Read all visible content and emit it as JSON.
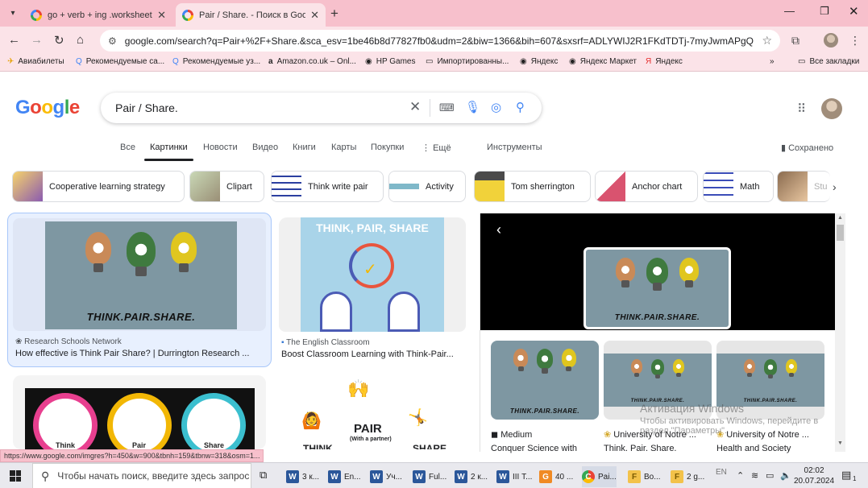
{
  "browser": {
    "tabs": [
      {
        "title": "go + verb + ing .worksheets pr"
      },
      {
        "title": "Pair / Share. - Поиск в Google"
      }
    ],
    "url": "google.com/search?q=Pair+%2F+Share.&sca_esv=1be46b8d77827fb0&udm=2&biw=1366&bih=607&sxsrf=ADLYWIJ2R1FKdTDTj-7myJwmAPgQkowRtg%3A1...",
    "bookmarks": [
      "Авиабилеты",
      "Рекомендуемые са...",
      "Рекомендуемые уз...",
      "Amazon.co.uk – Onl...",
      "HP Games",
      "Импортированны...",
      "Яндекс",
      "Яндекс Маркет",
      "Яндекс"
    ],
    "all_bookmarks": "Все закладки",
    "status_url": "https://www.google.com/imgres?h=450&w=900&tbnh=159&tbnw=318&osm=1..."
  },
  "google": {
    "logo": [
      "G",
      "o",
      "o",
      "g",
      "l",
      "e"
    ],
    "query": "Pair / Share.",
    "tabs": [
      "Все",
      "Картинки",
      "Новости",
      "Видео",
      "Книги",
      "Карты",
      "Покупки",
      "Ещё",
      "Инструменты"
    ],
    "saved": "Сохранено",
    "chips": [
      "Cooperative learning strategy",
      "Clipart",
      "Think write pair",
      "Activity",
      "Tom sherrington",
      "Anchor chart",
      "Math",
      "Stu"
    ],
    "results": [
      {
        "source": "Research Schools Network",
        "title": "How effective is Think Pair Share? | Durrington Research ...",
        "caption": "THINK.PAIR.SHARE."
      },
      {
        "source": "The English Classroom",
        "title": "Boost Classroom Learning with Think-Pair...",
        "caption": "THINK, PAIR, SHARE"
      },
      {
        "source": "",
        "title": "",
        "caption_words": [
          "Think",
          "Pair",
          "Share"
        ]
      },
      {
        "source": "",
        "title": "",
        "caption": "PAIR",
        "sub": "(With a partner)",
        "left": "THINK",
        "right": "SHARE"
      }
    ],
    "preview": {
      "caption": "THINK.PAIR.SHARE.",
      "related": [
        {
          "source": "Medium",
          "title": "Conquer Science with"
        },
        {
          "source": "University of Notre ...",
          "title": "Think. Pair. Share."
        },
        {
          "source": "University of Notre ...",
          "title": "Health and Society"
        }
      ]
    },
    "activation": {
      "title": "Активация Windows",
      "text": "Чтобы активировать Windows, перейдите в раздел \"Параметры\"."
    }
  },
  "taskbar": {
    "search_placeholder": "Чтобы начать поиск, введите здесь запрос",
    "items": [
      {
        "icon": "W",
        "label": "3 к..."
      },
      {
        "icon": "W",
        "label": "En..."
      },
      {
        "icon": "W",
        "label": "Уч..."
      },
      {
        "icon": "W",
        "label": "Ful..."
      },
      {
        "icon": "W",
        "label": "2 к..."
      },
      {
        "icon": "W",
        "label": "III Т..."
      },
      {
        "icon": "G",
        "label": "40 ..."
      },
      {
        "icon": "C",
        "label": "Pai..."
      },
      {
        "icon": "F",
        "label": "Bo..."
      },
      {
        "icon": "F",
        "label": "2 g..."
      }
    ],
    "lang": "EN",
    "time": "02:02",
    "date": "20.07.2024",
    "notifications": "1"
  },
  "colors": {
    "chrome_pink": "#f7c0cc",
    "google_blue": "#4285f4",
    "selected_card": "#e8f0fe"
  }
}
